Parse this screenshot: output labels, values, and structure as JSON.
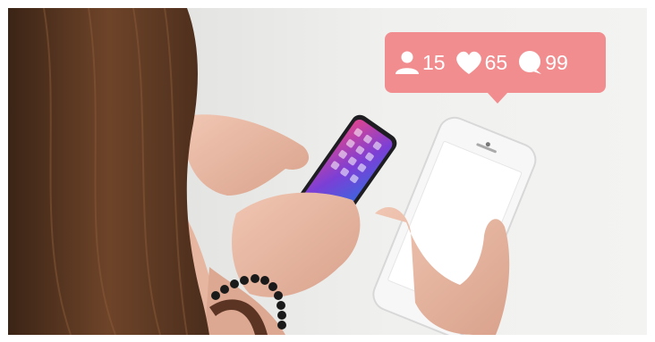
{
  "notification": {
    "followers": {
      "icon": "person-icon",
      "count": "15"
    },
    "likes": {
      "icon": "heart-icon",
      "count": "65"
    },
    "comments": {
      "icon": "comment-bubble-icon",
      "count": "99"
    }
  },
  "colors": {
    "badge": "#f28d8f",
    "badge_text": "#ffffff",
    "background": "#efefed",
    "hair": "#5a3622",
    "skin": "#e9b9a4",
    "phone_screen": "#ffffff"
  }
}
